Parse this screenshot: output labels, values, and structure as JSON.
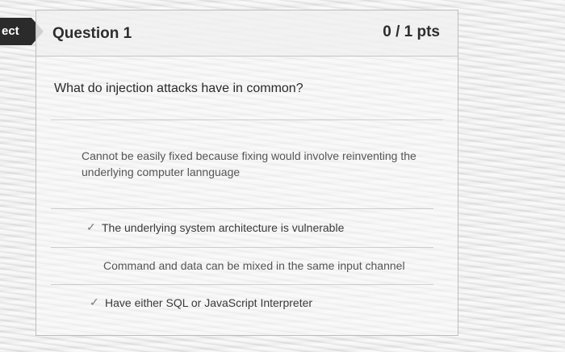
{
  "score_tab": {
    "label": "ect"
  },
  "question": {
    "title": "Question 1",
    "points": "0 / 1 pts",
    "prompt": "What do injection attacks have in common?"
  },
  "answers": [
    {
      "text": "Cannot be easily fixed because fixing would involve reinventing the underlying computer lannguage",
      "selected": false
    },
    {
      "text": "The underlying system architecture is vulnerable",
      "selected": true
    },
    {
      "text": "Command and data can be mixed in the same input channel",
      "selected": false
    },
    {
      "text": "Have either SQL or JavaScript Interpreter",
      "selected": true
    }
  ],
  "icons": {
    "selected_marker": "checkmark-icon",
    "selected_glyph": "✓"
  }
}
